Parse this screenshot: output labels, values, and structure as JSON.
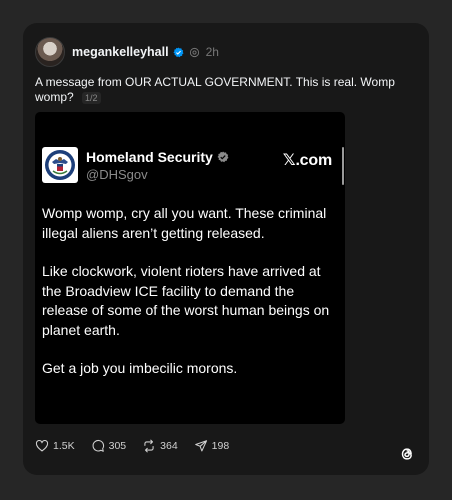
{
  "post": {
    "username": "megankelleyhall",
    "time": "2h",
    "text": "A message from OUR ACTUAL GOVERNMENT. This is real. Womp womp?",
    "page_indicator": "1/2"
  },
  "embed": {
    "account_name": "Homeland Security",
    "handle": "@DHSgov",
    "site": "𝕏.com",
    "paragraphs": [
      "Womp womp, cry all you want. These criminal illegal aliens aren’t getting released.",
      "Like clockwork, violent rioters have arrived at the Broadview ICE facility to demand the release of some of the worst human beings on planet earth.",
      "Get a job you imbecilic morons."
    ]
  },
  "actions": {
    "likes": "1.5K",
    "replies": "305",
    "reposts": "364",
    "shares": "198"
  },
  "icons": {
    "like": "heart-icon",
    "reply": "comment-icon",
    "repost": "repost-icon",
    "share": "send-icon",
    "verified": "verified-badge-icon",
    "app": "threads-logo-icon"
  },
  "colors": {
    "background": "#262626",
    "card": "#181818",
    "verified": "#0095f6",
    "text": "#f3f5f7"
  }
}
